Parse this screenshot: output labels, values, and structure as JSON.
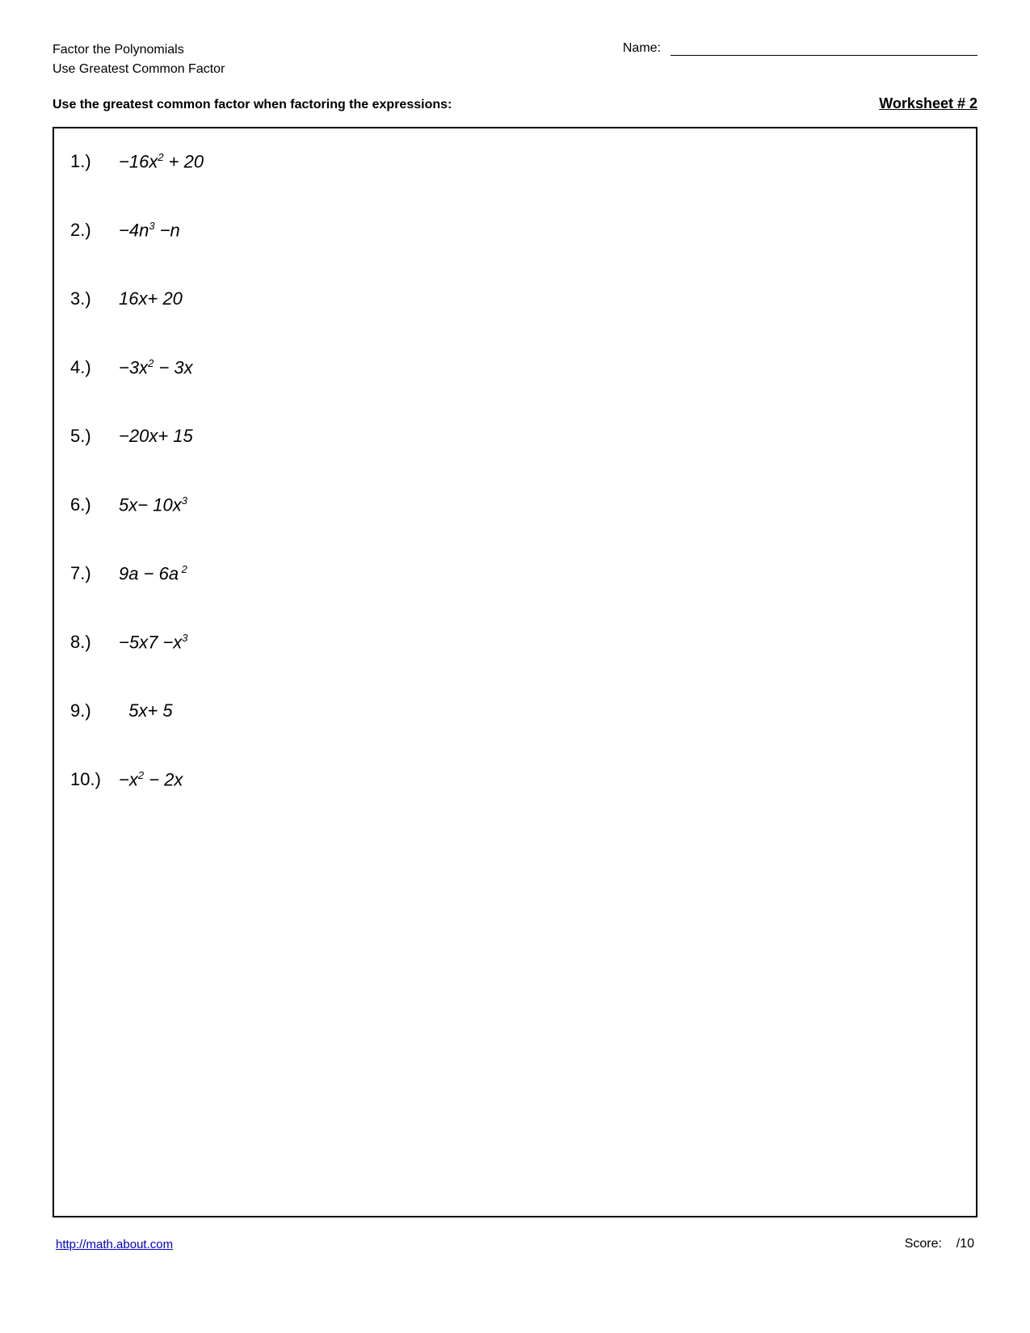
{
  "header": {
    "line1": "Factor the Polynomials",
    "line2": "Use Greatest Common Factor",
    "name_label": "Name:",
    "worksheet_title": "Worksheet # 2"
  },
  "instruction": {
    "text": "Use the greatest common factor when factoring the expressions:"
  },
  "problems": [
    {
      "number": "1.)",
      "html": "&minus;16<i>x</i><sup>2</sup> + 20"
    },
    {
      "number": "2.)",
      "html": "&minus;4<i>n</i><sup>3</sup> &minus;<i>n</i>"
    },
    {
      "number": "3.)",
      "html": "16<i>x</i>+ 20"
    },
    {
      "number": "4.)",
      "html": "&minus;3<i>x</i><sup>2</sup> &minus; 3<i>x</i>"
    },
    {
      "number": "5.)",
      "html": "&minus;20<i>x</i>+ 15"
    },
    {
      "number": "6.)",
      "html": "5<i>x</i>&minus; 10<i>x</i><sup>3</sup>"
    },
    {
      "number": "7.)",
      "html": "9<i>a</i> &minus; 6<i>a</i><sup> 2</sup>"
    },
    {
      "number": "8.)",
      "html": "&minus;5<i>x</i>7 &minus;<i>x</i><sup>3</sup>"
    },
    {
      "number": "9.)",
      "html": "&nbsp;&nbsp;5<i>x</i>+ 5"
    },
    {
      "number": "10.)",
      "html": "&minus;<i>x</i><sup>2</sup> &minus; 2<i>x</i>"
    }
  ],
  "footer": {
    "link_text": "http://math.about.com",
    "score_label": "Score:",
    "score_value": "/10"
  }
}
